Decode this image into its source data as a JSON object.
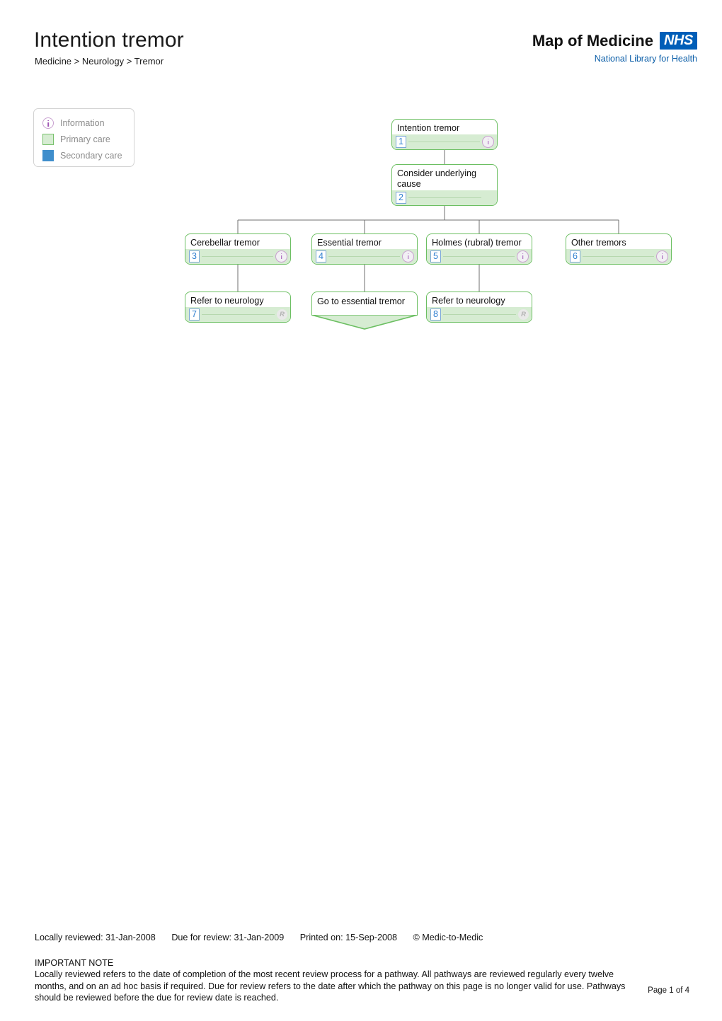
{
  "header": {
    "title": "Intention tremor",
    "breadcrumb": "Medicine > Neurology > Tremor",
    "brand_title": "Map of Medicine",
    "brand_logo": "NHS",
    "brand_subtitle": "National Library for Health"
  },
  "legend": {
    "items": [
      {
        "label": "Information",
        "icon": "information-icon",
        "color": "#a055b5"
      },
      {
        "label": "Primary care",
        "icon": "color-swatch",
        "color": "#d6ecd2"
      },
      {
        "label": "Secondary care",
        "icon": "color-swatch",
        "color": "#3f8ecc"
      }
    ]
  },
  "flowchart": {
    "nodes": [
      {
        "id": "1",
        "number": "1",
        "title": "Intention tremor",
        "icon": "information-icon",
        "care": "primary"
      },
      {
        "id": "2",
        "number": "2",
        "title": "Consider underlying cause",
        "icon": "none",
        "care": "primary"
      },
      {
        "id": "3",
        "number": "3",
        "title": "Cerebellar tremor",
        "icon": "information-icon",
        "care": "primary"
      },
      {
        "id": "4",
        "number": "4",
        "title": "Essential tremor",
        "icon": "information-icon",
        "care": "primary"
      },
      {
        "id": "5",
        "number": "5",
        "title": "Holmes (rubral) tremor",
        "icon": "information-icon",
        "care": "primary"
      },
      {
        "id": "6",
        "number": "6",
        "title": "Other tremors",
        "icon": "information-icon",
        "care": "primary"
      },
      {
        "id": "7",
        "number": "7",
        "title": "Refer to neurology",
        "icon": "referral-icon",
        "icon_label": "R",
        "care": "primary"
      },
      {
        "id": "goto",
        "number": "",
        "title": "Go to essential tremor",
        "icon": "none",
        "care": "primary",
        "shape": "goto"
      },
      {
        "id": "8",
        "number": "8",
        "title": "Refer to neurology",
        "icon": "referral-icon",
        "icon_label": "R",
        "care": "primary"
      }
    ],
    "edges": [
      {
        "from": "1",
        "to": "2"
      },
      {
        "from": "2",
        "to": "3"
      },
      {
        "from": "2",
        "to": "4"
      },
      {
        "from": "2",
        "to": "5"
      },
      {
        "from": "2",
        "to": "6"
      },
      {
        "from": "3",
        "to": "7"
      },
      {
        "from": "4",
        "to": "goto"
      },
      {
        "from": "5",
        "to": "8"
      }
    ]
  },
  "footer": {
    "locally_reviewed": "Locally reviewed: 31-Jan-2008",
    "due_for_review": "Due for review: 31-Jan-2009",
    "printed_on": "Printed on: 15-Sep-2008",
    "copyright": "© Medic-to-Medic",
    "note_heading": "IMPORTANT NOTE",
    "note_body": "Locally reviewed refers to the date of completion of the most recent review process for a pathway. All pathways are reviewed regularly every twelve months, and on an ad hoc basis if required. Due for review refers to the date after which the pathway on this page is no longer valid for use. Pathways should be reviewed before the due for review date is reached.",
    "page_number": "Page 1 of 4"
  }
}
